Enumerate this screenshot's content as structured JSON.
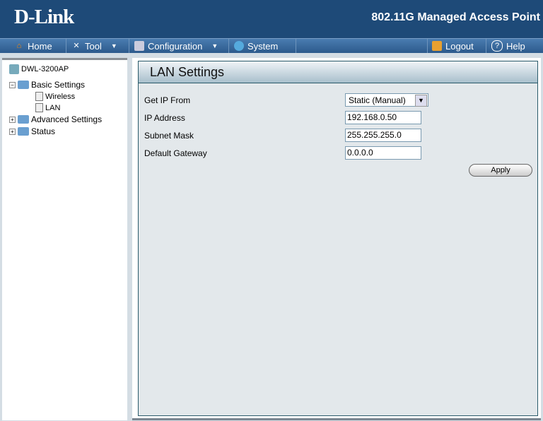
{
  "header": {
    "logo": "D-Link",
    "product": "802.11G Managed Access Point"
  },
  "nav": {
    "home": "Home",
    "tool": "Tool",
    "configuration": "Configuration",
    "system": "System",
    "logout": "Logout",
    "help": "Help"
  },
  "tree": {
    "root": "DWL-3200AP",
    "basic": "Basic Settings",
    "wireless": "Wireless",
    "lan": "LAN",
    "advanced": "Advanced Settings",
    "status": "Status"
  },
  "panel": {
    "title": "LAN Settings",
    "get_ip_label": "Get IP From",
    "get_ip_value": "Static (Manual)",
    "ip_label": "IP Address",
    "ip_value": "192.168.0.50",
    "mask_label": "Subnet Mask",
    "mask_value": "255.255.255.0",
    "gw_label": "Default Gateway",
    "gw_value": "0.0.0.0",
    "apply": "Apply"
  }
}
